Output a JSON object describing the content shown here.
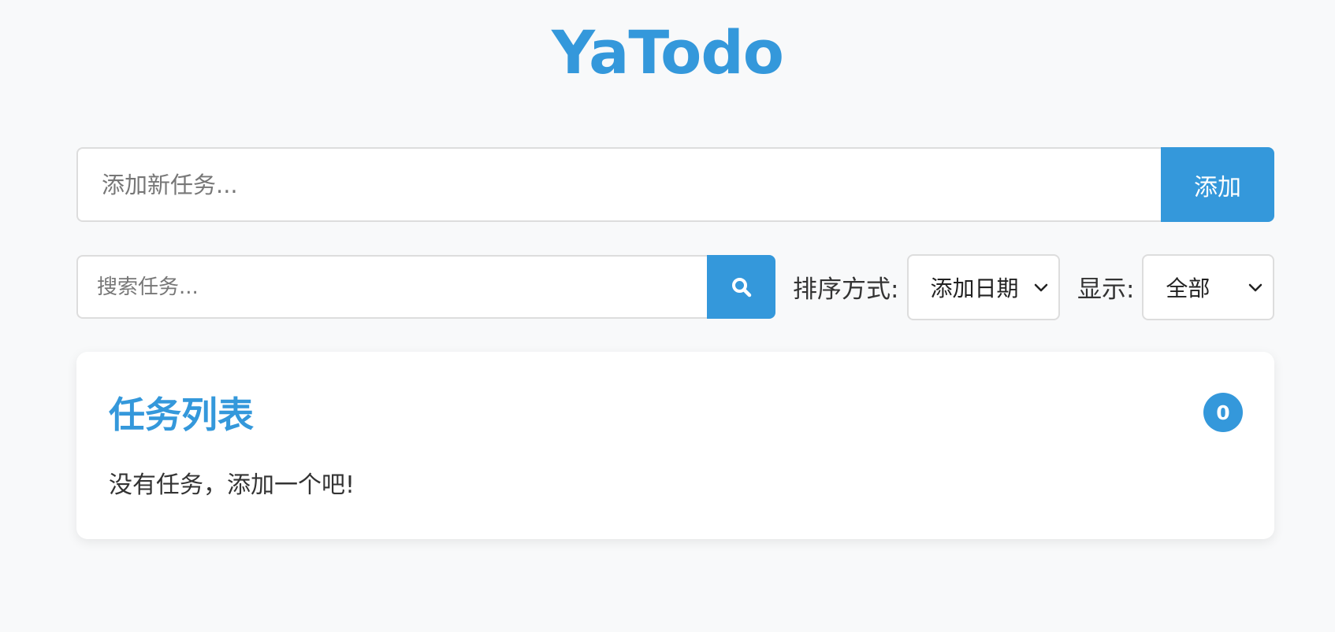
{
  "app": {
    "title": "YaTodo"
  },
  "add_task": {
    "placeholder": "添加新任务...",
    "value": "",
    "button_label": "添加"
  },
  "search": {
    "placeholder": "搜索任务...",
    "value": "",
    "icon": "search-icon"
  },
  "sort": {
    "label": "排序方式:",
    "selected": "添加日期"
  },
  "filter": {
    "label": "显示:",
    "selected": "全部"
  },
  "task_list": {
    "title": "任务列表",
    "count": "0",
    "empty_message": "没有任务，添加一个吧!"
  },
  "colors": {
    "accent": "#3498db",
    "background": "#f8f9fa",
    "card": "#ffffff",
    "border": "#dddddd"
  }
}
